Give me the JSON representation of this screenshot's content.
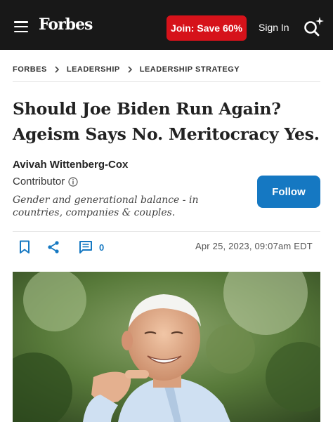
{
  "header": {
    "brand": "Forbes",
    "join_label": "Join: Save 60%",
    "signin_label": "Sign In"
  },
  "breadcrumb": [
    "FORBES",
    "LEADERSHIP",
    "LEADERSHIP STRATEGY"
  ],
  "article": {
    "title": "Should Joe Biden Run Again? Ageism Says No. Meritocracy Yes.",
    "author": "Avivah Wittenberg-Cox",
    "role": "Contributor",
    "bio": "Gender and generational balance - in countries, companies & couples.",
    "follow_label": "Follow",
    "comment_count": "0",
    "date": "Apr 25, 2023, 09:07am EDT"
  },
  "colors": {
    "header_bg": "#181818",
    "join_red": "#d6121a",
    "follow_blue": "#1578c2"
  },
  "icons": [
    "hamburger-icon",
    "search-sparkle-icon",
    "chevron-right-icon",
    "info-icon",
    "bookmark-icon",
    "share-icon",
    "comment-icon"
  ]
}
